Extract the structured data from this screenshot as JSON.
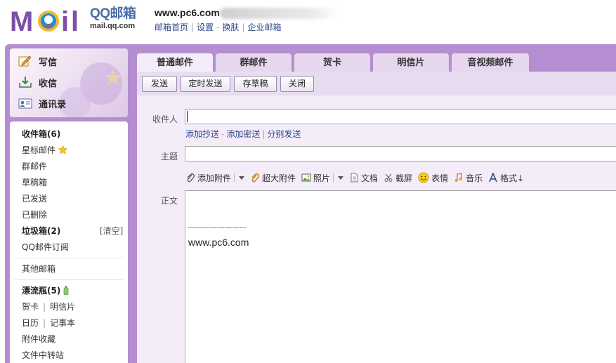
{
  "header": {
    "logo_qq": "QQ邮箱",
    "logo_domain": "mail.qq.com",
    "account": "www.pc6.com",
    "links": [
      "邮箱首页",
      "设置",
      "换肤",
      "企业邮箱"
    ],
    "link_separators": [
      "|",
      "-",
      "|"
    ]
  },
  "sidebar": {
    "compose": "写信",
    "inbox_check": "收信",
    "contacts": "通讯录",
    "folders": {
      "inbox": "收件箱(6)",
      "starred": "星标邮件",
      "group": "群邮件",
      "drafts": "草稿箱",
      "sent": "已发送",
      "deleted": "已删除",
      "spam": "垃圾箱(2)",
      "spam_clear": "[清空]",
      "subscriptions": "QQ邮件订阅",
      "other": "其他邮箱",
      "bottle": "漂流瓶(5)",
      "card": "贺卡",
      "postcard": "明信片",
      "calendar": "日历",
      "notes": "记事本",
      "attachments": "附件收藏",
      "transfer": "文件中转站",
      "pair_separator": "|"
    }
  },
  "tabs": [
    "普通邮件",
    "群邮件",
    "贺卡",
    "明信片",
    "音视频邮件"
  ],
  "toolbar": {
    "send": "发送",
    "timed_send": "定时发送",
    "save_draft": "存草稿",
    "close": "关闭"
  },
  "compose": {
    "to_label": "收件人",
    "to_value": "",
    "recipient_links": {
      "cc": "添加抄送",
      "sep1": "-",
      "bcc": "添加密送",
      "sep2": "|",
      "separate": "分别发送"
    },
    "subject_label": "主题",
    "subject_value": "",
    "attach_tools": {
      "add_attachment": "添加附件",
      "large_attachment": "超大附件",
      "photo": "照片",
      "document": "文档",
      "screenshot": "截屏",
      "emoticon": "表情",
      "music": "音乐",
      "format": "格式↓"
    },
    "body_label": "正文",
    "signature_line": "————————",
    "signature_text": "www.pc6.com"
  },
  "colors": {
    "frame_purple": "#b48ed0",
    "tab_purple": "#e6d7ef",
    "active_tab": "#f4ecf8",
    "link_blue": "#2b4a8a",
    "logo_purple": "#7d4fa8"
  }
}
